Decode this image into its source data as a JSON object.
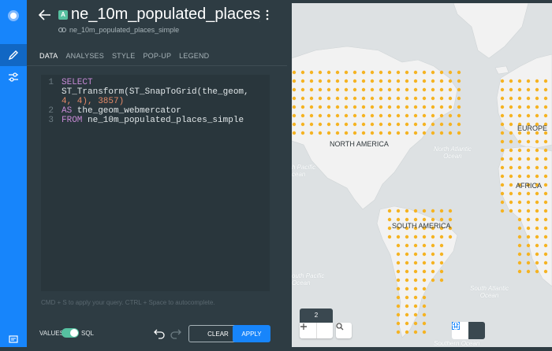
{
  "panel": {
    "title": "ne_10m_populated_places_...",
    "layer_letter": "A",
    "source": "ne_10m_populated_places_simple",
    "tabs": [
      "DATA",
      "ANALYSES",
      "STYLE",
      "POP-UP",
      "LEGEND"
    ],
    "active_tab": "DATA"
  },
  "editor": {
    "lines": [
      {
        "num": "1",
        "keyword": "SELECT",
        "rest": ""
      },
      {
        "num": "",
        "keyword": "",
        "rest": "ST_Transform(ST_SnapToGrid(the_geom,"
      },
      {
        "num": "",
        "keyword": "",
        "rest": "4, 4), 3857)"
      },
      {
        "num": "2",
        "keyword": "AS",
        "rest": " the_geom_webmercator"
      },
      {
        "num": "3",
        "keyword": "FROM",
        "rest": " ne_10m_populated_places_simple"
      }
    ],
    "hint": "CMD + S to apply your query. CTRL + Space to autocomplete."
  },
  "footer": {
    "values_label": "VALUES",
    "sql_label": "SQL",
    "sql_mode_on": true,
    "clear_label": "CLEAR",
    "apply_label": "APPLY"
  },
  "map": {
    "zoom_level": "2",
    "dot_color": "#f5b322",
    "labels": {
      "north_america": "NORTH AMERICA",
      "south_america": "SOUTH AMERICA",
      "europe": "EUROPE",
      "africa": "AFRICA"
    },
    "oceans": {
      "north_atlantic_1": "North Atlantic",
      "north_atlantic_2": "Ocean",
      "south_atlantic_1": "South Atlantic",
      "south_atlantic_2": "Ocean",
      "pacific_north_1": "h Pacific",
      "pacific_north_2": "cean",
      "pacific_south_1": "outh Pacific",
      "pacific_south_2": "Ocean",
      "southern_ocean": "Southern Ocean"
    }
  },
  "colors": {
    "accent": "#1785fb",
    "toggle": "#56c0a0",
    "panel_bg": "#2e3c43"
  }
}
